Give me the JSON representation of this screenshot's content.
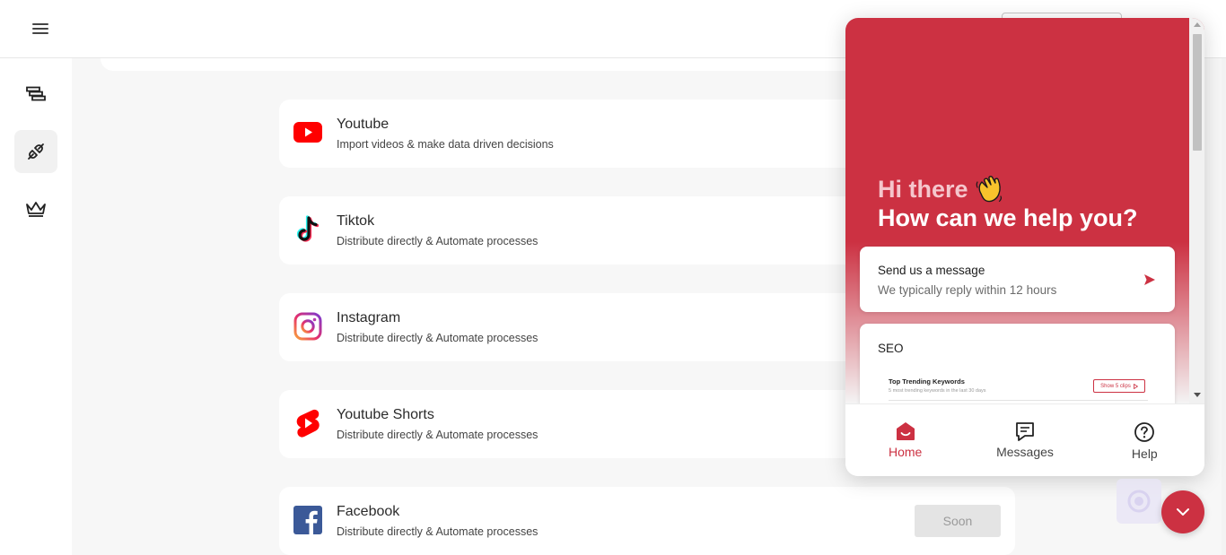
{
  "header": {
    "menu_icon": "hamburger-icon"
  },
  "sidebar": {
    "items": [
      {
        "icon": "stack-icon",
        "active": false
      },
      {
        "icon": "plug-icon",
        "active": true
      },
      {
        "icon": "crown-icon",
        "active": false
      }
    ]
  },
  "integrations": [
    {
      "title": "Youtube",
      "description": "Import videos & make data driven decisions",
      "icon": "youtube-icon"
    },
    {
      "title": "Tiktok",
      "description": "Distribute directly & Automate processes",
      "icon": "tiktok-icon"
    },
    {
      "title": "Instagram",
      "description": "Distribute directly & Automate processes",
      "icon": "instagram-icon"
    },
    {
      "title": "Youtube Shorts",
      "description": "Distribute directly & Automate processes",
      "icon": "youtube-shorts-icon"
    },
    {
      "title": "Facebook",
      "description": "Distribute directly & Automate processes",
      "icon": "facebook-icon",
      "button": "Soon"
    }
  ],
  "chat": {
    "greeting": "Hi there",
    "greeting_icon": "waving-hand-icon",
    "headline": "How can we help you?",
    "message_card": {
      "title": "Send us a message",
      "subtitle": "We typically reply within 12 hours"
    },
    "seo_card": {
      "title": "SEO",
      "preview_title": "Top Trending Keywords",
      "preview_subtitle": "5 most trending keywords in the last 30 days",
      "preview_button": "Show 5 clips"
    },
    "nav": {
      "home": "Home",
      "messages": "Messages",
      "help": "Help"
    }
  },
  "colors": {
    "brand": "#cc3142",
    "youtube": "#ff0000",
    "facebook": "#3b5998"
  }
}
